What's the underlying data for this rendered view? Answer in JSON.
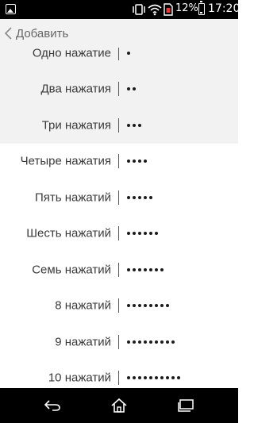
{
  "status_bar": {
    "battery": "12%",
    "time": "17:20",
    "icons": [
      "image-notification-icon",
      "vibrate-icon",
      "wifi-icon",
      "no-sim-icon",
      "battery-icon"
    ]
  },
  "header": {
    "back_label": "Добавить",
    "icon": "chevron-left-icon"
  },
  "list": {
    "items": [
      {
        "label": "Одно нажатие",
        "dots": 1,
        "highlighted": true
      },
      {
        "label": "Два нажатия",
        "dots": 2,
        "highlighted": true
      },
      {
        "label": "Три нажатия",
        "dots": 3,
        "highlighted": true
      },
      {
        "label": "Четыре нажатия",
        "dots": 4,
        "highlighted": false
      },
      {
        "label": "Пять нажатий",
        "dots": 5,
        "highlighted": false
      },
      {
        "label": "Шесть нажатий",
        "dots": 6,
        "highlighted": false
      },
      {
        "label": "Семь нажатий",
        "dots": 7,
        "highlighted": false
      },
      {
        "label": "8 нажатий",
        "dots": 8,
        "highlighted": false
      },
      {
        "label": "9 нажатий",
        "dots": 9,
        "highlighted": false
      },
      {
        "label": "10 нажатий",
        "dots": 10,
        "highlighted": false
      }
    ]
  },
  "nav_bar": {
    "icons": [
      "back-icon",
      "home-icon",
      "recent-apps-icon"
    ]
  }
}
